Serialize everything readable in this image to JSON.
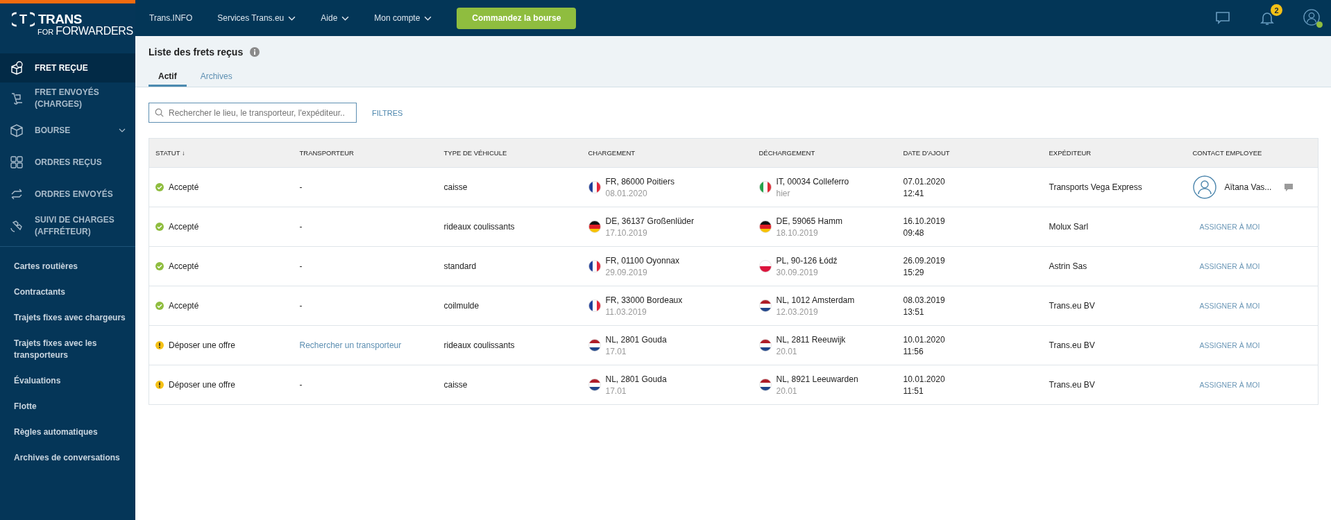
{
  "logo": {
    "mark": "T",
    "name": "TRANS",
    "prefix": "FOR",
    "tagline": "FORWARDERS"
  },
  "sidebar": {
    "items": [
      {
        "label": "FRET REÇUE",
        "selected": true,
        "dropdown": false
      },
      {
        "label": "FRET ENVOYÉS (CHARGES)",
        "selected": false,
        "dropdown": false
      },
      {
        "label": "BOURSE",
        "selected": false,
        "dropdown": true
      },
      {
        "label": "ORDRES REÇUS",
        "selected": false,
        "dropdown": false
      },
      {
        "label": "ORDRES ENVOYÉS",
        "selected": false,
        "dropdown": false
      },
      {
        "label": "SUIVI DE CHARGES (AFFRÉTEUR)",
        "selected": false,
        "dropdown": false
      }
    ],
    "links": [
      "Cartes routières",
      "Contractants",
      "Trajets fixes avec chargeurs",
      "Trajets fixes avec les transporteurs",
      "Évaluations",
      "Flotte",
      "Règles automatiques",
      "Archives de conversations"
    ]
  },
  "top_nav": {
    "items": [
      {
        "label": "Trans.INFO",
        "dropdown": false
      },
      {
        "label": "Services Trans.eu",
        "dropdown": true
      },
      {
        "label": "Aide",
        "dropdown": true
      },
      {
        "label": "Mon compte",
        "dropdown": true
      }
    ],
    "cta": "Commandez la bourse",
    "notifications": "2",
    "online": true
  },
  "page": {
    "title": "Liste des frets reçus",
    "tabs": [
      {
        "label": "Actif",
        "selected": true
      },
      {
        "label": "Archives",
        "selected": false
      }
    ],
    "search": {
      "placeholder": "Rechercher le lieu, le transporteur, l'expéditeur.."
    },
    "filters": "FILTRES"
  },
  "table": {
    "columns": [
      "STATUT ↓",
      "TRANSPORTEUR",
      "TYPE DE VÉHICULE",
      "CHARGEMENT",
      "DÉCHARGEMENT",
      "DATE D'AJOUT",
      "EXPÉDITEUR",
      "CONTACT EMPLOYEE"
    ],
    "rows": [
      {
        "status": {
          "kind": "accepted",
          "label": "Accepté"
        },
        "carrier": {
          "kind": "text",
          "label": "-"
        },
        "vehicle": "caisse",
        "loading": {
          "kind": "fr",
          "place": "FR, 86000 Poitiers",
          "date": "08.01.2020"
        },
        "unloading": {
          "kind": "it",
          "place": "IT, 00034 Colleferro",
          "date": "hier"
        },
        "added": {
          "date": "07.01.2020",
          "time": "12:41"
        },
        "shipper": "Transports Vega Express",
        "contact": {
          "kind": "person",
          "label": "Aïtana Vas..."
        }
      },
      {
        "status": {
          "kind": "accepted",
          "label": "Accepté"
        },
        "carrier": {
          "kind": "text",
          "label": "-"
        },
        "vehicle": "rideaux coulissants",
        "loading": {
          "kind": "de",
          "place": "DE, 36137 Großenlüder",
          "date": "17.10.2019"
        },
        "unloading": {
          "kind": "de",
          "place": "DE, 59065 Hamm",
          "date": "18.10.2019"
        },
        "added": {
          "date": "16.10.2019",
          "time": "09:48"
        },
        "shipper": "Molux Sarl",
        "contact": {
          "kind": "assign",
          "label": "ASSIGNER À MOI"
        }
      },
      {
        "status": {
          "kind": "accepted",
          "label": "Accepté"
        },
        "carrier": {
          "kind": "text",
          "label": "-"
        },
        "vehicle": "standard",
        "loading": {
          "kind": "fr",
          "place": "FR, 01100 Oyonnax",
          "date": "29.09.2019"
        },
        "unloading": {
          "kind": "pl",
          "place": "PL, 90-126 Łódź",
          "date": "30.09.2019"
        },
        "added": {
          "date": "26.09.2019",
          "time": "15:29"
        },
        "shipper": "Astrin Sas",
        "contact": {
          "kind": "assign",
          "label": "ASSIGNER À MOI"
        }
      },
      {
        "status": {
          "kind": "accepted",
          "label": "Accepté"
        },
        "carrier": {
          "kind": "text",
          "label": "-"
        },
        "vehicle": "coilmulde",
        "loading": {
          "kind": "fr",
          "place": "FR, 33000 Bordeaux",
          "date": "11.03.2019"
        },
        "unloading": {
          "kind": "nl",
          "place": "NL, 1012 Amsterdam",
          "date": "12.03.2019"
        },
        "added": {
          "date": "08.03.2019",
          "time": "13:51"
        },
        "shipper": "Trans.eu BV",
        "contact": {
          "kind": "assign",
          "label": "ASSIGNER À MOI"
        }
      },
      {
        "status": {
          "kind": "offer",
          "label": "Déposer une offre"
        },
        "carrier": {
          "kind": "link",
          "label": "Rechercher un transporteur"
        },
        "vehicle": "rideaux coulissants",
        "loading": {
          "kind": "nl",
          "place": "NL, 2801 Gouda",
          "date": "17.01"
        },
        "unloading": {
          "kind": "nl",
          "place": "NL, 2811 Reeuwijk",
          "date": "20.01"
        },
        "added": {
          "date": "10.01.2020",
          "time": "11:56"
        },
        "shipper": "Trans.eu BV",
        "contact": {
          "kind": "assign",
          "label": "ASSIGNER À MOI"
        }
      },
      {
        "status": {
          "kind": "offer",
          "label": "Déposer une offre"
        },
        "carrier": {
          "kind": "text",
          "label": "-"
        },
        "vehicle": "caisse",
        "loading": {
          "kind": "nl",
          "place": "NL, 2801 Gouda",
          "date": "17.01"
        },
        "unloading": {
          "kind": "nl",
          "place": "NL, 8921 Leeuwarden",
          "date": "20.01"
        },
        "added": {
          "date": "10.01.2020",
          "time": "11:51"
        },
        "shipper": "Trans.eu BV",
        "contact": {
          "kind": "assign",
          "label": "ASSIGNER À MOI"
        }
      }
    ]
  }
}
